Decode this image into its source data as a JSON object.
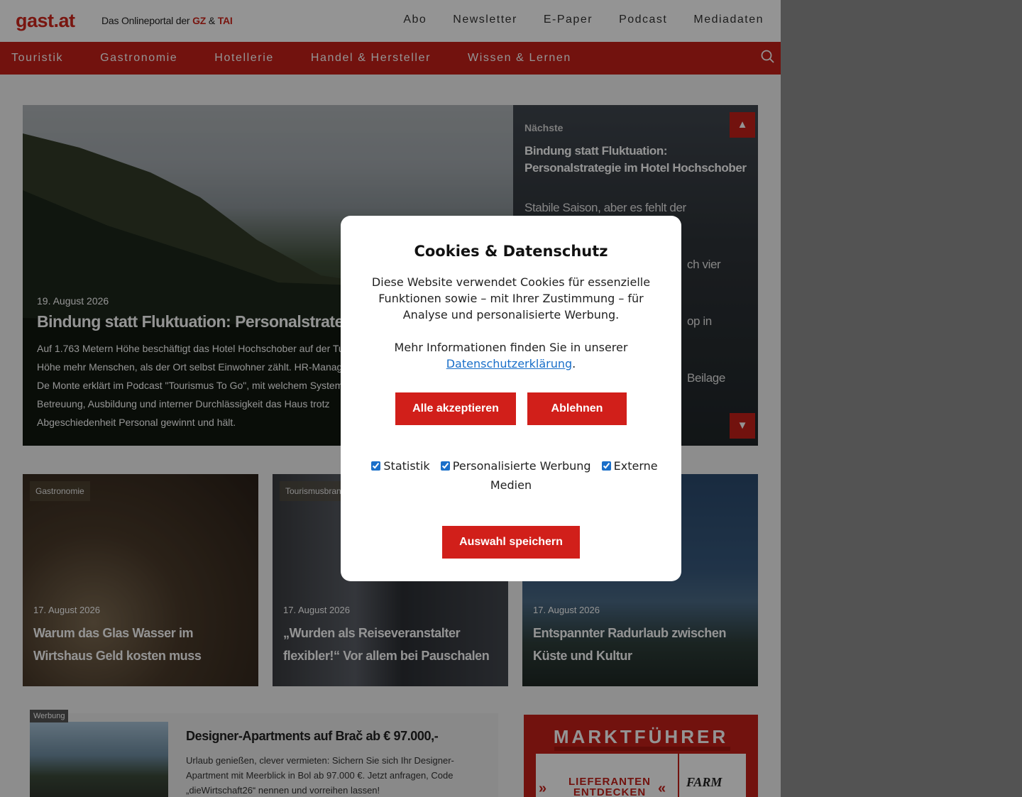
{
  "header": {
    "logo": "gast.at",
    "tagline_prefix": "Das Onlineportal der",
    "tagline_brand1": "GZ",
    "tagline_amp": "&",
    "tagline_brand2": "TAI",
    "top_links": [
      "Abo",
      "Newsletter",
      "E-Paper",
      "Podcast",
      "Mediadaten"
    ]
  },
  "nav": {
    "items": [
      "Touristik",
      "Gastronomie",
      "Hotellerie",
      "Handel & Hersteller",
      "Wissen & Lernen"
    ],
    "search_icon": "search-icon"
  },
  "hero": {
    "date": "19. August 2026",
    "title": "Bindung statt Fluktuation: Personalstrategie im Ho",
    "teaser": "Auf 1.763 Metern Höhe beschäftigt das Hotel Hochschober auf der Turra Höhe mehr Menschen, als der Ort selbst Einwohner zählt. HR-Managerin De Monte erklärt im Podcast \"Tourismus To Go\", mit welchem System au Betreuung, Ausbildung und interner Durchlässigkeit das Haus trotz Abgeschiedenheit Personal gewinnt und hält."
  },
  "side": {
    "next_label": "Nächste",
    "items": [
      "Bindung statt Fluktuation: Personalstrategie im Hotel Hochschober",
      "Stabile Saison, aber es fehlt der Nachwuchs an",
      "ch vier",
      "op in",
      "Beilage"
    ],
    "up_arrow": "▲",
    "down_arrow": "▼"
  },
  "cards": [
    {
      "category": "Gastronomie",
      "date": "17. August 2026",
      "title": "Warum das Glas Wasser im Wirtshaus Geld kosten muss"
    },
    {
      "category": "Tourismusbran",
      "date": "17. August 2026",
      "title": "„Wurden als Reiseveranstalter flexibler!“ Vor allem bei Pauschalen"
    },
    {
      "category": "",
      "date": "17. August 2026",
      "title": "Entspannter Radurlaub zwischen Küste und Kultur"
    }
  ],
  "ad": {
    "label": "Werbung",
    "title": "Designer-Apartments auf Brač ab € 97.000,-",
    "text": "Urlaub genießen, clever vermieten: Sichern Sie sich Ihr Designer-Apartment mit Meerblick in Bol ab 97.000 €. Jetzt anfragen, Code „dieWirtschaft26“ nennen und vorreihen lassen!"
  },
  "promo": {
    "head": "MARKTFÜHRER",
    "cta": "LIEFERANTEN ENTDECKEN",
    "brand": "FARM"
  },
  "modal": {
    "title": "Cookies & Datenschutz",
    "text": "Diese Website verwendet Cookies für essenzielle Funktionen sowie – mit Ihrer Zustimmung – für Analyse und personalisierte Werbung.",
    "more_prefix": "Mehr Informationen finden Sie in unserer",
    "more_link": "Datenschutzerklärung",
    "more_suffix": ".",
    "accept": "Alle akzeptieren",
    "decline": "Ablehnen",
    "options": [
      {
        "label": "Statistik",
        "checked": true
      },
      {
        "label": "Personalisierte Werbung",
        "checked": true
      },
      {
        "label": "Externe Medien",
        "checked": true
      }
    ],
    "save": "Auswahl speichern"
  },
  "colors": {
    "brand_red": "#c41f19",
    "button_red": "#d11f1a",
    "link_blue": "#1a6fc9"
  }
}
